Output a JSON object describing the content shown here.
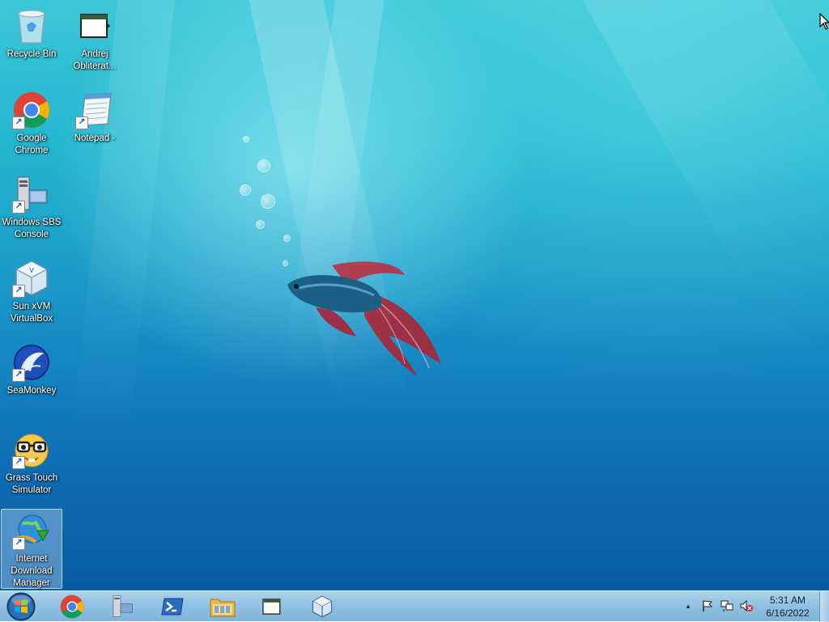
{
  "desktop": {
    "icons": [
      {
        "label": "Recycle Bin",
        "icon": "recycle-bin-icon"
      },
      {
        "label": "Andrej Obliterat...",
        "icon": "folder-window-icon"
      },
      {
        "label": "Google Chrome",
        "icon": "chrome-icon"
      },
      {
        "label": "Notepad -",
        "icon": "notepad-icon"
      },
      {
        "label": "Windows SBS Console",
        "icon": "server-console-icon"
      },
      {
        "label": "Sun xVM VirtualBox",
        "icon": "virtualbox-icon"
      },
      {
        "label": "SeaMonkey",
        "icon": "seamonkey-icon"
      },
      {
        "label": "Grass Touch Simulator",
        "icon": "nerd-face-icon"
      },
      {
        "label": "Internet Download Manager",
        "icon": "idm-globe-icon"
      }
    ],
    "shortcut_glyph": "↗"
  },
  "taskbar": {
    "start": "start-orb-icon",
    "pinned": [
      {
        "icon": "chrome-icon",
        "name": "Google Chrome"
      },
      {
        "icon": "server-console-icon",
        "name": "Windows SBS Console"
      },
      {
        "icon": "powershell-icon",
        "name": "Windows PowerShell"
      },
      {
        "icon": "file-explorer-icon",
        "name": "Windows Explorer"
      },
      {
        "icon": "folder-window-icon",
        "name": "Andrej Obliterator"
      },
      {
        "icon": "virtualbox-icon",
        "name": "VirtualBox"
      }
    ],
    "tray": {
      "show_hidden_glyph": "▲",
      "icons": [
        "action-center-flag-icon",
        "network-icon",
        "volume-muted-icon"
      ]
    },
    "clock": {
      "time": "5:31 AM",
      "date": "6/16/2022"
    }
  },
  "colors": {
    "desktop_top": "#3cc7d8",
    "desktop_bottom": "#0a5aa5",
    "taskbar": "#8cbee1"
  }
}
